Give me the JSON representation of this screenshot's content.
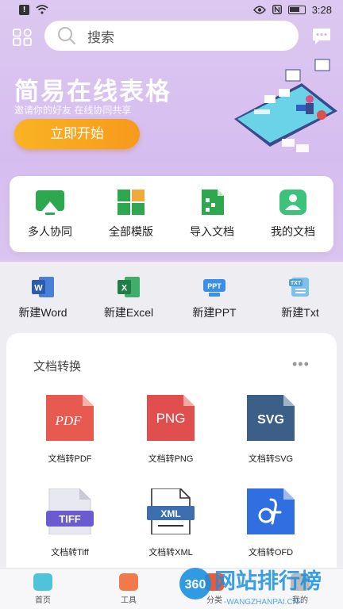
{
  "status_bar": {
    "time": "3:28"
  },
  "search": {
    "placeholder": "搜索"
  },
  "hero": {
    "title": "简易在线表格",
    "subtitle": "邀请你的好友 在线协同共享",
    "start_button": "立即开始"
  },
  "quick_actions": [
    {
      "label": "多人协同",
      "icon": "collaboration-icon"
    },
    {
      "label": "全部模版",
      "icon": "templates-icon"
    },
    {
      "label": "导入文档",
      "icon": "import-doc-icon"
    },
    {
      "label": "我的文档",
      "icon": "my-docs-icon"
    }
  ],
  "new_docs": [
    {
      "label": "新建Word",
      "icon": "word-icon"
    },
    {
      "label": "新建Excel",
      "icon": "excel-icon"
    },
    {
      "label": "新建PPT",
      "icon": "ppt-icon"
    },
    {
      "label": "新建Txt",
      "icon": "txt-icon"
    }
  ],
  "conversion": {
    "title": "文档转换",
    "more": "•••",
    "items": [
      {
        "label": "文档转PDF",
        "badge": "PDF",
        "color": "#e85a4f"
      },
      {
        "label": "文档转PNG",
        "badge": "PNG",
        "color": "#e04e4e"
      },
      {
        "label": "文档转SVG",
        "badge": "SVG",
        "color": "#3b5f86"
      },
      {
        "label": "文档转Tiff",
        "badge": "TIFF",
        "color": "#6b5bd1"
      },
      {
        "label": "文档转XML",
        "badge": "XML",
        "color": "#3d6fb0"
      },
      {
        "label": "文档转OFD",
        "badge": "",
        "color": "#2f6fe0"
      }
    ]
  },
  "tabbar": [
    {
      "label": "首页",
      "color": "#4fc3d8"
    },
    {
      "label": "工具",
      "color": "#f07a4a"
    },
    {
      "label": "分类",
      "color": "#e85a3a"
    },
    {
      "label": "我的",
      "color": "#999999"
    }
  ],
  "watermark": {
    "text": "网站排行榜",
    "number": "360",
    "url": "-WANGZHANPAI.CN-"
  }
}
